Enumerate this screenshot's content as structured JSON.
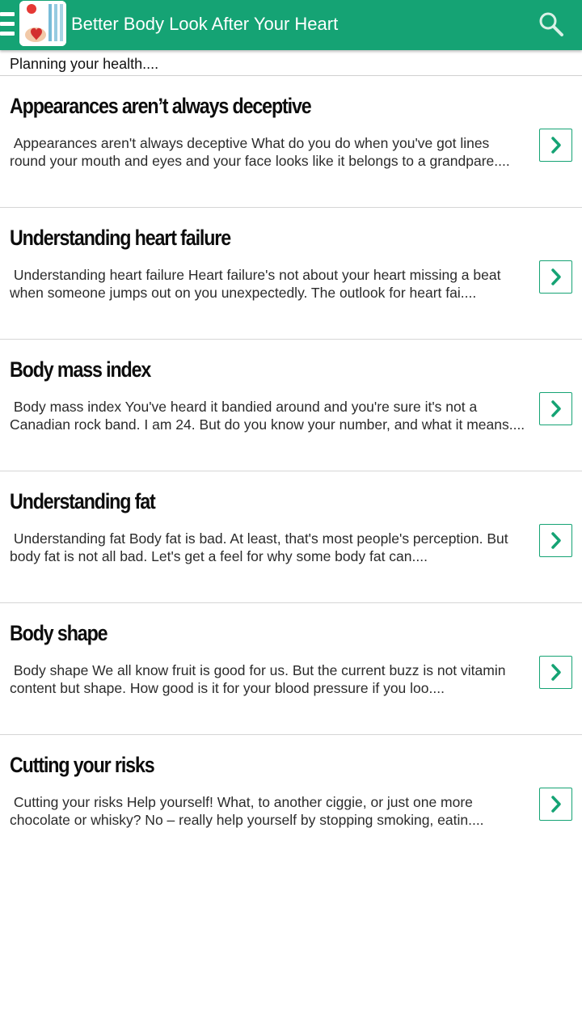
{
  "colors": {
    "accent": "#15a374",
    "title_text": "#0d0d0d",
    "body_text": "#2b2b2b"
  },
  "appbar": {
    "menu_icon": "hamburger-menu-icon",
    "logo_icon": "app-logo-icon",
    "title": "Better Body Look After Your Heart",
    "search_icon": "search-icon"
  },
  "subtitle": "Planning your health....",
  "articles": [
    {
      "title": "Appearances aren’t always deceptive",
      "description": " Appearances aren't always deceptive What do you do when you've got lines round your mouth and eyes and your face looks like it belongs to a grandpare....",
      "action_icon": "chevron-right-icon"
    },
    {
      "title": "Understanding heart failure",
      "description": " Understanding heart failure Heart failure's not about your heart missing a beat when someone jumps out on you unexpectedly. The outlook for heart fai....",
      "action_icon": "chevron-right-icon"
    },
    {
      "title": "Body mass index",
      "description": " Body mass index You've heard it bandied around and you're sure it's not a Canadian rock band. I am 24. But do you know your number, and what it means....",
      "action_icon": "chevron-right-icon"
    },
    {
      "title": "Understanding fat",
      "description": " Understanding fat Body fat is bad. At least, that's most people's perception. But body fat is not all bad. Let's get a feel for why some body fat can....",
      "action_icon": "chevron-right-icon"
    },
    {
      "title": "Body shape",
      "description": " Body shape We all know fruit is good for us. But the current buzz is not vitamin content but shape. How good is it for your blood pressure if you loo....",
      "action_icon": "chevron-right-icon"
    },
    {
      "title": "Cutting your risks",
      "description": " Cutting your risks Help yourself! What, to another ciggie, or just one more chocolate or whisky? No – really help yourself by stopping smoking, eatin....",
      "action_icon": "chevron-right-icon"
    }
  ]
}
